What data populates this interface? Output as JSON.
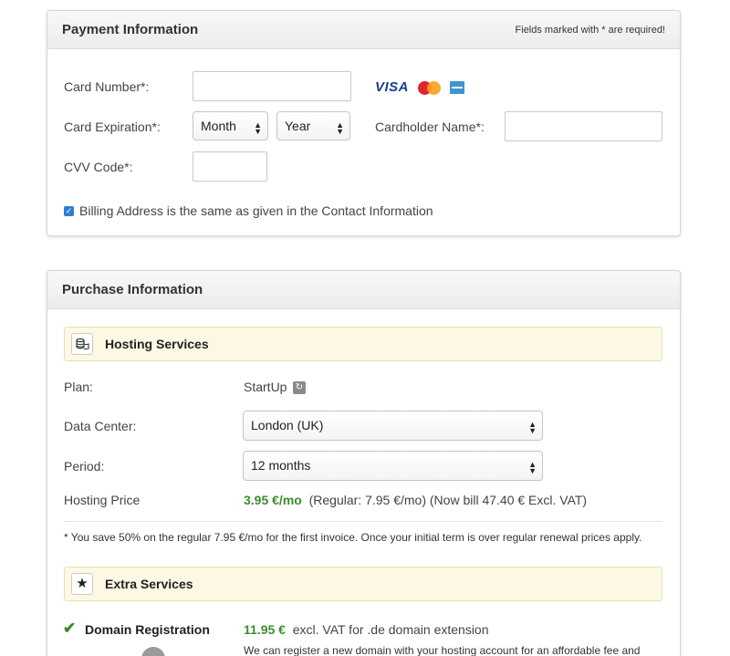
{
  "payment": {
    "title": "Payment Information",
    "required_note": "Fields marked with * are required!",
    "card_number_label": "Card Number*:",
    "card_brands": [
      "VISA",
      "MasterCard",
      "American Express"
    ],
    "visa_text": "VISA",
    "expiration_label": "Card Expiration*:",
    "month_value": "Month",
    "year_value": "Year",
    "cardholder_label": "Cardholder Name*:",
    "cvv_label": "CVV Code*:",
    "billing_same_label": "Billing Address is the same as given in the Contact Information",
    "billing_same_checked": true
  },
  "purchase": {
    "title": "Purchase Information",
    "hosting": {
      "title": "Hosting Services",
      "plan_label": "Plan:",
      "plan_value": "StartUp",
      "datacenter_label": "Data Center:",
      "datacenter_value": "London (UK)",
      "period_label": "Period:",
      "period_value": "12 months",
      "price_label": "Hosting Price",
      "price_value": "3.95 €/mo",
      "price_detail": "(Regular: 7.95 €/mo) (Now bill 47.40 € Excl. VAT)",
      "savings_note": "* You save 50% on the regular 7.95 €/mo for the first invoice. Once your initial term is over regular renewal prices apply."
    },
    "extra": {
      "title": "Extra Services",
      "domain_label": "Domain Registration",
      "domain_price": "11.95 €",
      "domain_price_detail": "excl. VAT for .de domain extension",
      "domain_description": "We can register a new domain with your hosting account for an affordable fee and"
    }
  },
  "colors": {
    "accent_green": "#3c8c2e",
    "checkbox_blue": "#2e7dd4",
    "section_bar_bg": "#fdf8e3"
  }
}
